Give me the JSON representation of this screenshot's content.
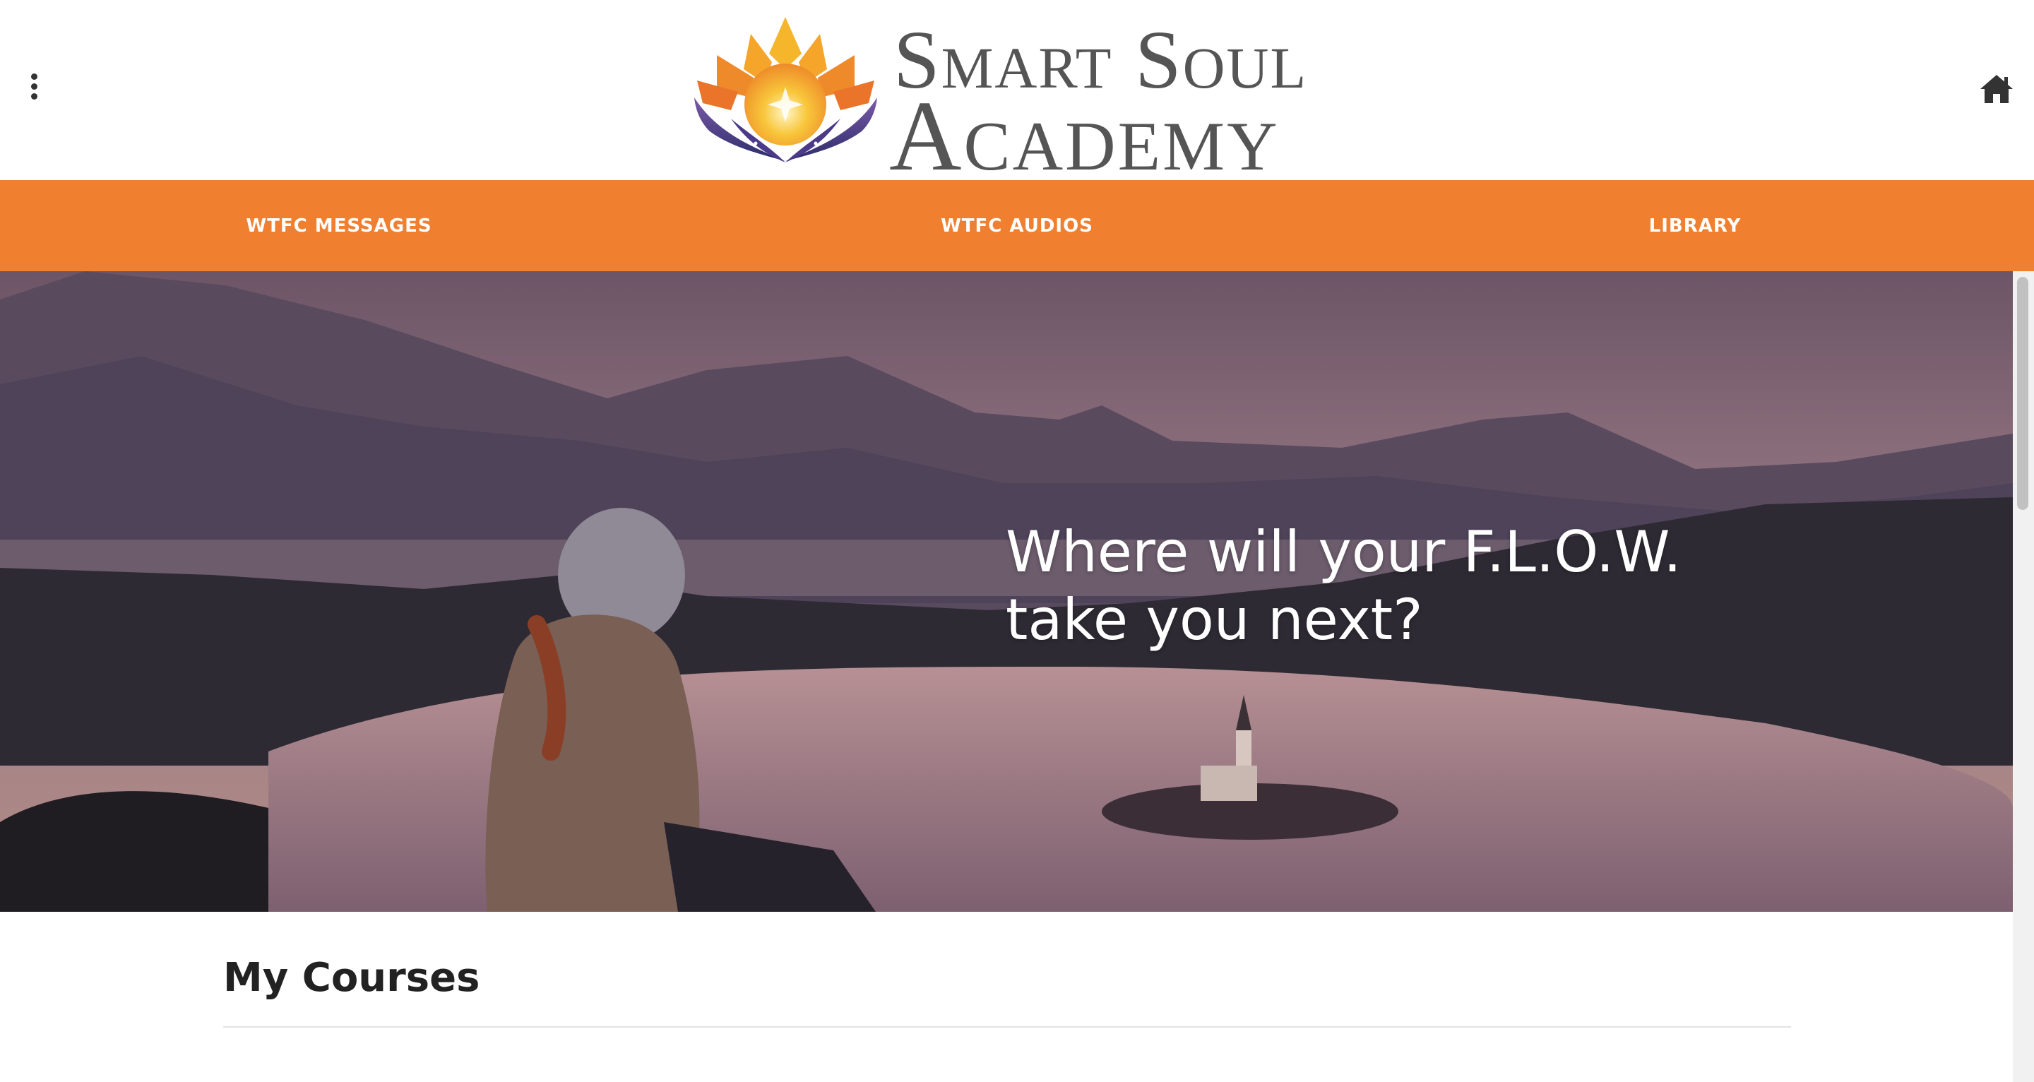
{
  "header": {
    "logo": {
      "line1": "Smart Soul",
      "line2": "Academy"
    },
    "menu_icon": "more-vertical-icon",
    "home_icon": "home-icon"
  },
  "nav": {
    "items": [
      {
        "label": "WTFC MESSAGES"
      },
      {
        "label": "WTFC AUDIOS"
      },
      {
        "label": "LIBRARY"
      }
    ]
  },
  "hero": {
    "headline_line1": "Where will your F.L.O.W.",
    "headline_line2": "take you next?"
  },
  "courses": {
    "title": "My Courses"
  },
  "colors": {
    "nav_bg": "#f08030",
    "nav_text": "#ffffff",
    "logo_text": "#555555"
  }
}
